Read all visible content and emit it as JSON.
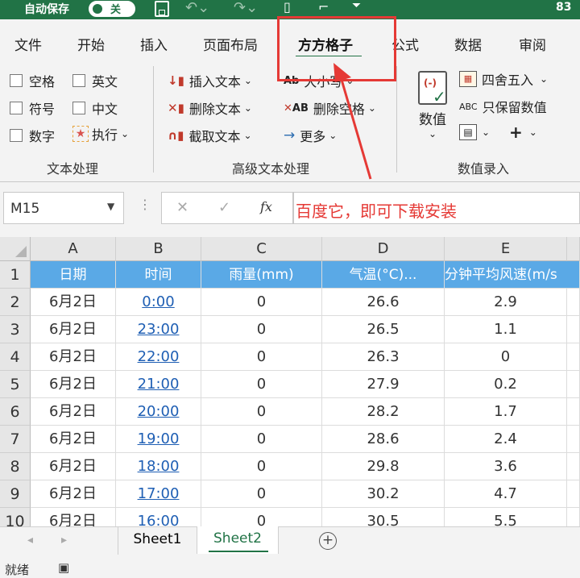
{
  "titlebar": {
    "autosave_label": "自动保存",
    "autosave_state": "关",
    "right_text": "83"
  },
  "tabs": [
    {
      "label": "文件"
    },
    {
      "label": "开始"
    },
    {
      "label": "插入"
    },
    {
      "label": "页面布局"
    },
    {
      "label": "方方格子",
      "active": true
    },
    {
      "label": "公式"
    },
    {
      "label": "数据"
    },
    {
      "label": "审阅"
    }
  ],
  "ribbon": {
    "text_group": {
      "checkboxes": [
        {
          "label": "空格"
        },
        {
          "label": "英文"
        },
        {
          "label": "符号"
        },
        {
          "label": "中文"
        },
        {
          "label": "数字"
        }
      ],
      "execute_label": "执行",
      "label": "文本处理"
    },
    "advanced_group": {
      "insert_text": "插入文本",
      "delete_text": "删除文本",
      "extract_text": "截取文本",
      "case_label": "大小写",
      "delete_spaces": "删除空格",
      "more": "更多",
      "label": "高级文本处理"
    },
    "value_group": {
      "value_button": "数值",
      "round": "四舍五入",
      "keep_values": "只保留数值",
      "label": "数值录入"
    }
  },
  "formula_bar": {
    "name_box": "M15",
    "fx": "fx",
    "content": "百度它，即可下载安装"
  },
  "grid": {
    "columns": [
      "A",
      "B",
      "C",
      "D",
      "E"
    ],
    "header_row": [
      "日期",
      "时间",
      "雨量(mm)",
      "气温(°C)...",
      "分钟平均风速(m/s"
    ],
    "rows": [
      {
        "n": "2",
        "date": "6月2日",
        "time": "0:00",
        "rain": "0",
        "temp": "26.6",
        "wind": "2.9"
      },
      {
        "n": "3",
        "date": "6月2日",
        "time": "23:00",
        "rain": "0",
        "temp": "26.5",
        "wind": "1.1"
      },
      {
        "n": "4",
        "date": "6月2日",
        "time": "22:00",
        "rain": "0",
        "temp": "26.3",
        "wind": "0"
      },
      {
        "n": "5",
        "date": "6月2日",
        "time": "21:00",
        "rain": "0",
        "temp": "27.9",
        "wind": "0.2"
      },
      {
        "n": "6",
        "date": "6月2日",
        "time": "20:00",
        "rain": "0",
        "temp": "28.2",
        "wind": "1.7"
      },
      {
        "n": "7",
        "date": "6月2日",
        "time": "19:00",
        "rain": "0",
        "temp": "28.6",
        "wind": "2.4"
      },
      {
        "n": "8",
        "date": "6月2日",
        "time": "18:00",
        "rain": "0",
        "temp": "29.8",
        "wind": "3.6"
      },
      {
        "n": "9",
        "date": "6月2日",
        "time": "17:00",
        "rain": "0",
        "temp": "30.2",
        "wind": "4.7"
      },
      {
        "n": "10",
        "date": "6月2日",
        "time": "16:00",
        "rain": "0",
        "temp": "30.5",
        "wind": "5.5"
      }
    ]
  },
  "sheets": [
    {
      "label": "Sheet1"
    },
    {
      "label": "Sheet2",
      "active": true
    }
  ],
  "status": {
    "ready": "就绪"
  },
  "colors": {
    "excel_green": "#217346",
    "header_blue": "#5aa9e6",
    "link_blue": "#1f5fb4",
    "annotation_red": "#e53935"
  }
}
